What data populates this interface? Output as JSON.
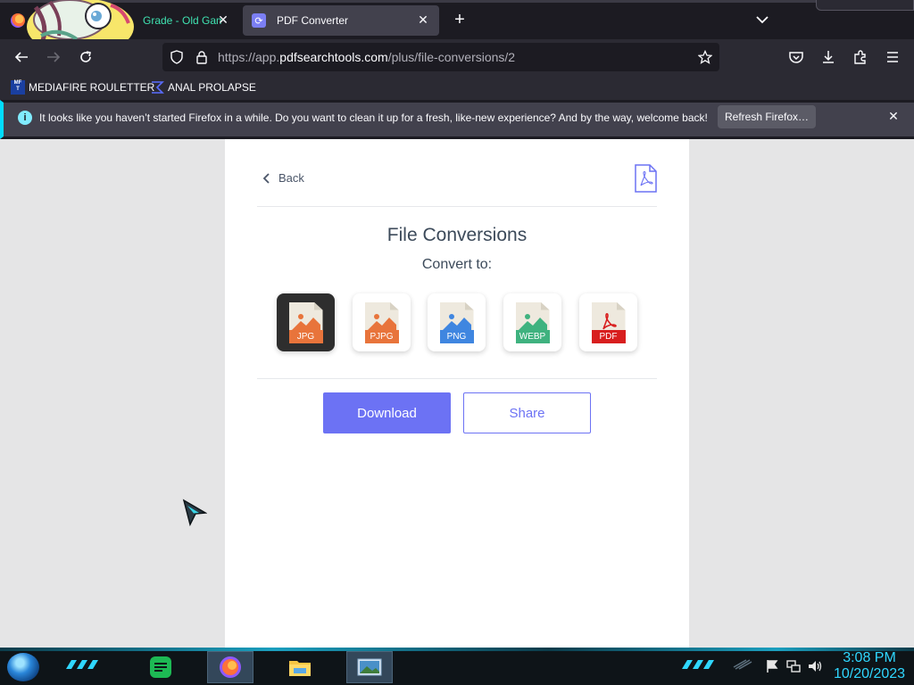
{
  "browser": {
    "tabs": [
      {
        "title": "Grade - Old Gam",
        "active": false
      },
      {
        "title": "PDF Converter",
        "active": true
      }
    ],
    "url": {
      "prefix": "https://app.",
      "host": "pdfsearchtools.com",
      "path": "/plus/file-conversions/2"
    },
    "bookmarks": [
      {
        "label": "MEDIAFIRE ROULETTER",
        "icon_text": "MF\nT"
      },
      {
        "label": "ANAL PROLAPSE"
      }
    ],
    "notification": {
      "message": "It looks like you haven’t started Firefox in a while. Do you want to clean it up for a fresh, like-new experience? And by the way, welcome back!",
      "button": "Refresh Firefox…"
    }
  },
  "page": {
    "back_label": "Back",
    "title": "File Conversions",
    "subtitle": "Convert to:",
    "formats": [
      {
        "label": "JPG",
        "selected": true,
        "color": "#e8743b"
      },
      {
        "label": "PJPG",
        "selected": false,
        "color": "#e8743b"
      },
      {
        "label": "PNG",
        "selected": false,
        "color": "#3f86e0"
      },
      {
        "label": "WEBP",
        "selected": false,
        "color": "#3fb27f"
      },
      {
        "label": "PDF",
        "selected": false,
        "color": "#d81e1e"
      }
    ],
    "download_label": "Download",
    "share_label": "Share",
    "accent_color": "#6c72f4"
  },
  "taskbar": {
    "time": "3:08 PM",
    "date": "10/20/2023"
  }
}
